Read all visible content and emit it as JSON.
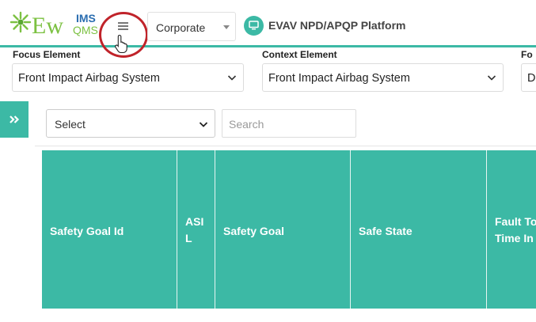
{
  "header": {
    "logo": {
      "prefix": "Ew",
      "suffix_top": "IMS",
      "suffix_bottom": "QMS"
    },
    "org_select": {
      "value": "Corporate"
    },
    "platform": {
      "label": "EVAV NPD/APQP Platform"
    }
  },
  "filters": {
    "focus": {
      "label": "Focus Element",
      "value": "Front Impact Airbag System"
    },
    "context": {
      "label": "Context Element",
      "value": "Front Impact Airbag System"
    },
    "third": {
      "label": "Fo",
      "value": "D"
    }
  },
  "toolbar": {
    "select_value": "Select",
    "search_placeholder": "Search"
  },
  "table": {
    "columns": [
      "Safety Goal Id",
      "ASI L",
      "Safety Goal",
      "Safe State",
      "Fault Tolerant Time Interval"
    ],
    "column_display": [
      "Safety Goal Id",
      "ASI\nL",
      "Safety Goal",
      "Safe State",
      "Fault To\nTime In"
    ]
  },
  "colors": {
    "accent": "#3cb9a5",
    "highlight_circle": "#c0232a"
  },
  "icons": {
    "menu": "hamburger-icon",
    "platform": "monitor-icon",
    "sidebar_toggle": "double-chevron-right-icon"
  }
}
